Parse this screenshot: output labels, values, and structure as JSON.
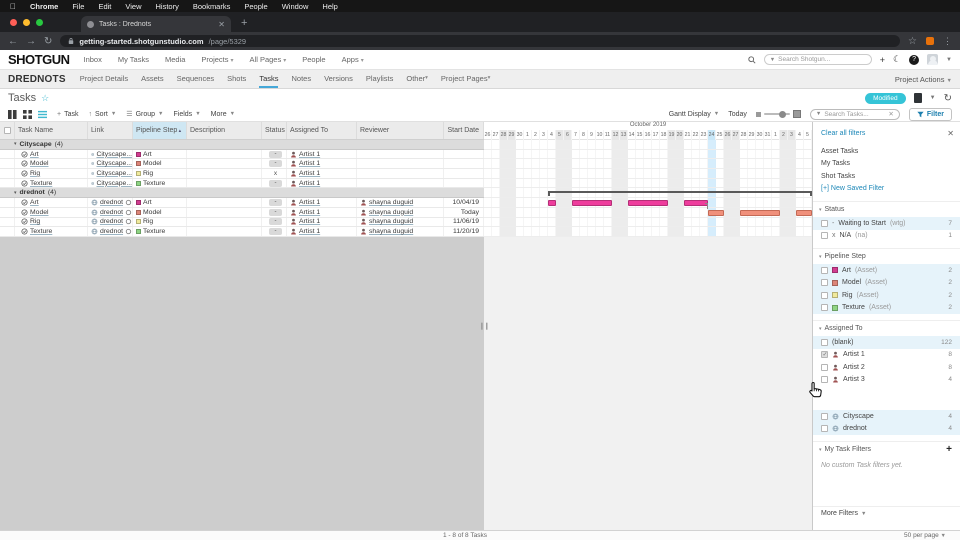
{
  "menubar": {
    "items": [
      "Chrome",
      "File",
      "Edit",
      "View",
      "History",
      "Bookmarks",
      "People",
      "Window",
      "Help"
    ]
  },
  "browser": {
    "tab_title": "Tasks : Drednots",
    "url_host": "getting-started.shotgunstudio.com",
    "url_path": "/page/5329"
  },
  "sg_header": {
    "logo": "SHOTGUN",
    "nav": [
      "Inbox",
      "My Tasks",
      "Media",
      "Projects",
      "All Pages",
      "People",
      "Apps"
    ],
    "dropdown_nav": [
      "Projects",
      "All Pages",
      "Apps"
    ],
    "search_placeholder": "Search Shotgun..."
  },
  "project_nav": {
    "project": "DREDNOTS",
    "items": [
      "Project Details",
      "Assets",
      "Sequences",
      "Shots",
      "Tasks",
      "Notes",
      "Versions",
      "Playlists",
      "Other",
      "Project Pages"
    ],
    "active": "Tasks",
    "dropdowns": [
      "Other",
      "Project Pages"
    ],
    "actions": "Project Actions"
  },
  "page_header": {
    "title": "Tasks",
    "badge": "Modified"
  },
  "toolbar": {
    "add_task": "Task",
    "sort": "Sort",
    "group": "Group",
    "fields": "Fields",
    "more": "More",
    "gantt_display": "Gantt Display",
    "today": "Today",
    "search_placeholder": "Search Tasks...",
    "filter": "Filter"
  },
  "table": {
    "columns": [
      "Task Name",
      "Link",
      "Pipeline Step",
      "Description",
      "Status",
      "Assigned To",
      "Reviewer",
      "Start Date"
    ],
    "sorted_column": "Pipeline Step",
    "groups": [
      {
        "name": "Cityscape",
        "count": "(4)",
        "rows": [
          {
            "task": "Art",
            "link": "Cityscape...",
            "link_suffix": false,
            "step": "Art",
            "step_color": "#d23c90",
            "status": "-",
            "status_badge": true,
            "assigned": "Artist 1",
            "reviewer": "",
            "start": ""
          },
          {
            "task": "Model",
            "link": "Cityscape...",
            "link_suffix": false,
            "step": "Model",
            "step_color": "#dd8578",
            "status": "-",
            "status_badge": true,
            "assigned": "Artist 1",
            "reviewer": "",
            "start": ""
          },
          {
            "task": "Rig",
            "link": "Cityscape...",
            "link_suffix": false,
            "step": "Rig",
            "step_color": "#f0ea9c",
            "status": "x",
            "status_badge": false,
            "assigned": "Artist 1",
            "reviewer": "",
            "start": ""
          },
          {
            "task": "Texture",
            "link": "Cityscape...",
            "link_suffix": false,
            "step": "Texture",
            "step_color": "#8fd584",
            "status": "-",
            "status_badge": true,
            "assigned": "Artist 1",
            "reviewer": "",
            "start": ""
          }
        ]
      },
      {
        "name": "drednot",
        "count": "(4)",
        "rows": [
          {
            "task": "Art",
            "link": "drednot",
            "link_suffix": true,
            "step": "Art",
            "step_color": "#d23c90",
            "status": "-",
            "status_badge": true,
            "assigned": "Artist 1",
            "reviewer": "shayna duguid",
            "start": "10/04/19"
          },
          {
            "task": "Model",
            "link": "drednot",
            "link_suffix": true,
            "step": "Model",
            "step_color": "#dd8578",
            "status": "-",
            "status_badge": true,
            "assigned": "Artist 1",
            "reviewer": "shayna duguid",
            "start": "Today"
          },
          {
            "task": "Rig",
            "link": "drednot",
            "link_suffix": true,
            "step": "Rig",
            "step_color": "#f0ea9c",
            "status": "-",
            "status_badge": true,
            "assigned": "Artist 1",
            "reviewer": "shayna duguid",
            "start": "11/06/19"
          },
          {
            "task": "Texture",
            "link": "drednot",
            "link_suffix": true,
            "step": "Texture",
            "step_color": "#8fd584",
            "status": "-",
            "status_badge": true,
            "assigned": "Artist 1",
            "reviewer": "shayna duguid",
            "start": "11/20/19"
          }
        ]
      }
    ]
  },
  "gantt": {
    "month_label": "October 2019",
    "day_labels": [
      "26",
      "27",
      "28",
      "29",
      "30",
      "1",
      "2",
      "3",
      "4",
      "5",
      "6",
      "7",
      "8",
      "9",
      "10",
      "11",
      "12",
      "13",
      "14",
      "15",
      "16",
      "17",
      "18",
      "19",
      "20",
      "21",
      "22",
      "23",
      "24",
      "25",
      "26",
      "27",
      "28",
      "29",
      "30",
      "31",
      "1",
      "2",
      "3",
      "4",
      "5"
    ],
    "weekend_indices": [
      2,
      3,
      9,
      10,
      16,
      17,
      23,
      24,
      30,
      31,
      37,
      38
    ],
    "today_index": 28,
    "day_width": 8,
    "bars": [
      {
        "kind": "summary",
        "name": "drednot-summary-bar",
        "row": 5,
        "start": 8,
        "end": 41,
        "color": "#595959"
      },
      {
        "kind": "task",
        "name": "art-task-bar",
        "row": 6,
        "start": 8,
        "end": 28,
        "color": "#ee3d9d",
        "border": "#b52f77"
      },
      {
        "kind": "task",
        "name": "model-task-bar",
        "row": 7,
        "start": 28,
        "end": 41,
        "color": "#f0907b",
        "border": "#c46a55"
      }
    ]
  },
  "filters": {
    "clear_label": "Clear all filters",
    "saved_filters": [
      "Asset Tasks",
      "My Tasks",
      "Shot Tasks"
    ],
    "new_saved_filter": "[+] New Saved Filter",
    "sections": {
      "status": {
        "title": "Status",
        "items": [
          {
            "glyph": "-",
            "label": "Waiting to Start",
            "code": "(wtg)",
            "count": "7",
            "hl": true,
            "checked": false
          },
          {
            "glyph": "x",
            "label": "N/A",
            "code": "(na)",
            "count": "1",
            "hl": false,
            "checked": false
          }
        ]
      },
      "pipeline": {
        "title": "Pipeline Step",
        "items": [
          {
            "color": "#d23c90",
            "label": "Art",
            "code": "(Asset)",
            "count": "2",
            "hl": true,
            "checked": false
          },
          {
            "color": "#dd8578",
            "label": "Model",
            "code": "(Asset)",
            "count": "2",
            "hl": true,
            "checked": false
          },
          {
            "color": "#f0ea9c",
            "label": "Rig",
            "code": "(Asset)",
            "count": "2",
            "hl": true,
            "checked": false
          },
          {
            "color": "#8fd584",
            "label": "Texture",
            "code": "(Asset)",
            "count": "2",
            "hl": true,
            "checked": false
          }
        ]
      },
      "assigned": {
        "title": "Assigned To",
        "items": [
          {
            "icon": "none",
            "label": "(blank)",
            "code": "",
            "count": "122",
            "hl": true,
            "checked": false
          },
          {
            "icon": "person",
            "label": "Artist 1",
            "code": "",
            "count": "8",
            "hl": false,
            "checked": true
          },
          {
            "icon": "person",
            "label": "Artist 2",
            "code": "",
            "count": "8",
            "hl": false,
            "checked": false
          },
          {
            "icon": "person",
            "label": "Artist 3",
            "code": "",
            "count": "4",
            "hl": false,
            "checked": false
          }
        ]
      },
      "links": {
        "items": [
          {
            "icon": "globe",
            "label": "Cityscape",
            "code": "",
            "count": "4",
            "hl": true,
            "checked": false
          },
          {
            "icon": "globe",
            "label": "drednot",
            "code": "",
            "count": "4",
            "hl": true,
            "checked": false
          }
        ]
      },
      "my_task_filters": {
        "title": "My Task Filters",
        "empty": "No custom Task filters yet."
      }
    },
    "more_label": "More Filters"
  },
  "footer": {
    "range_label": "1 - 8 of 8 Tasks",
    "per_page": "50 per page"
  }
}
